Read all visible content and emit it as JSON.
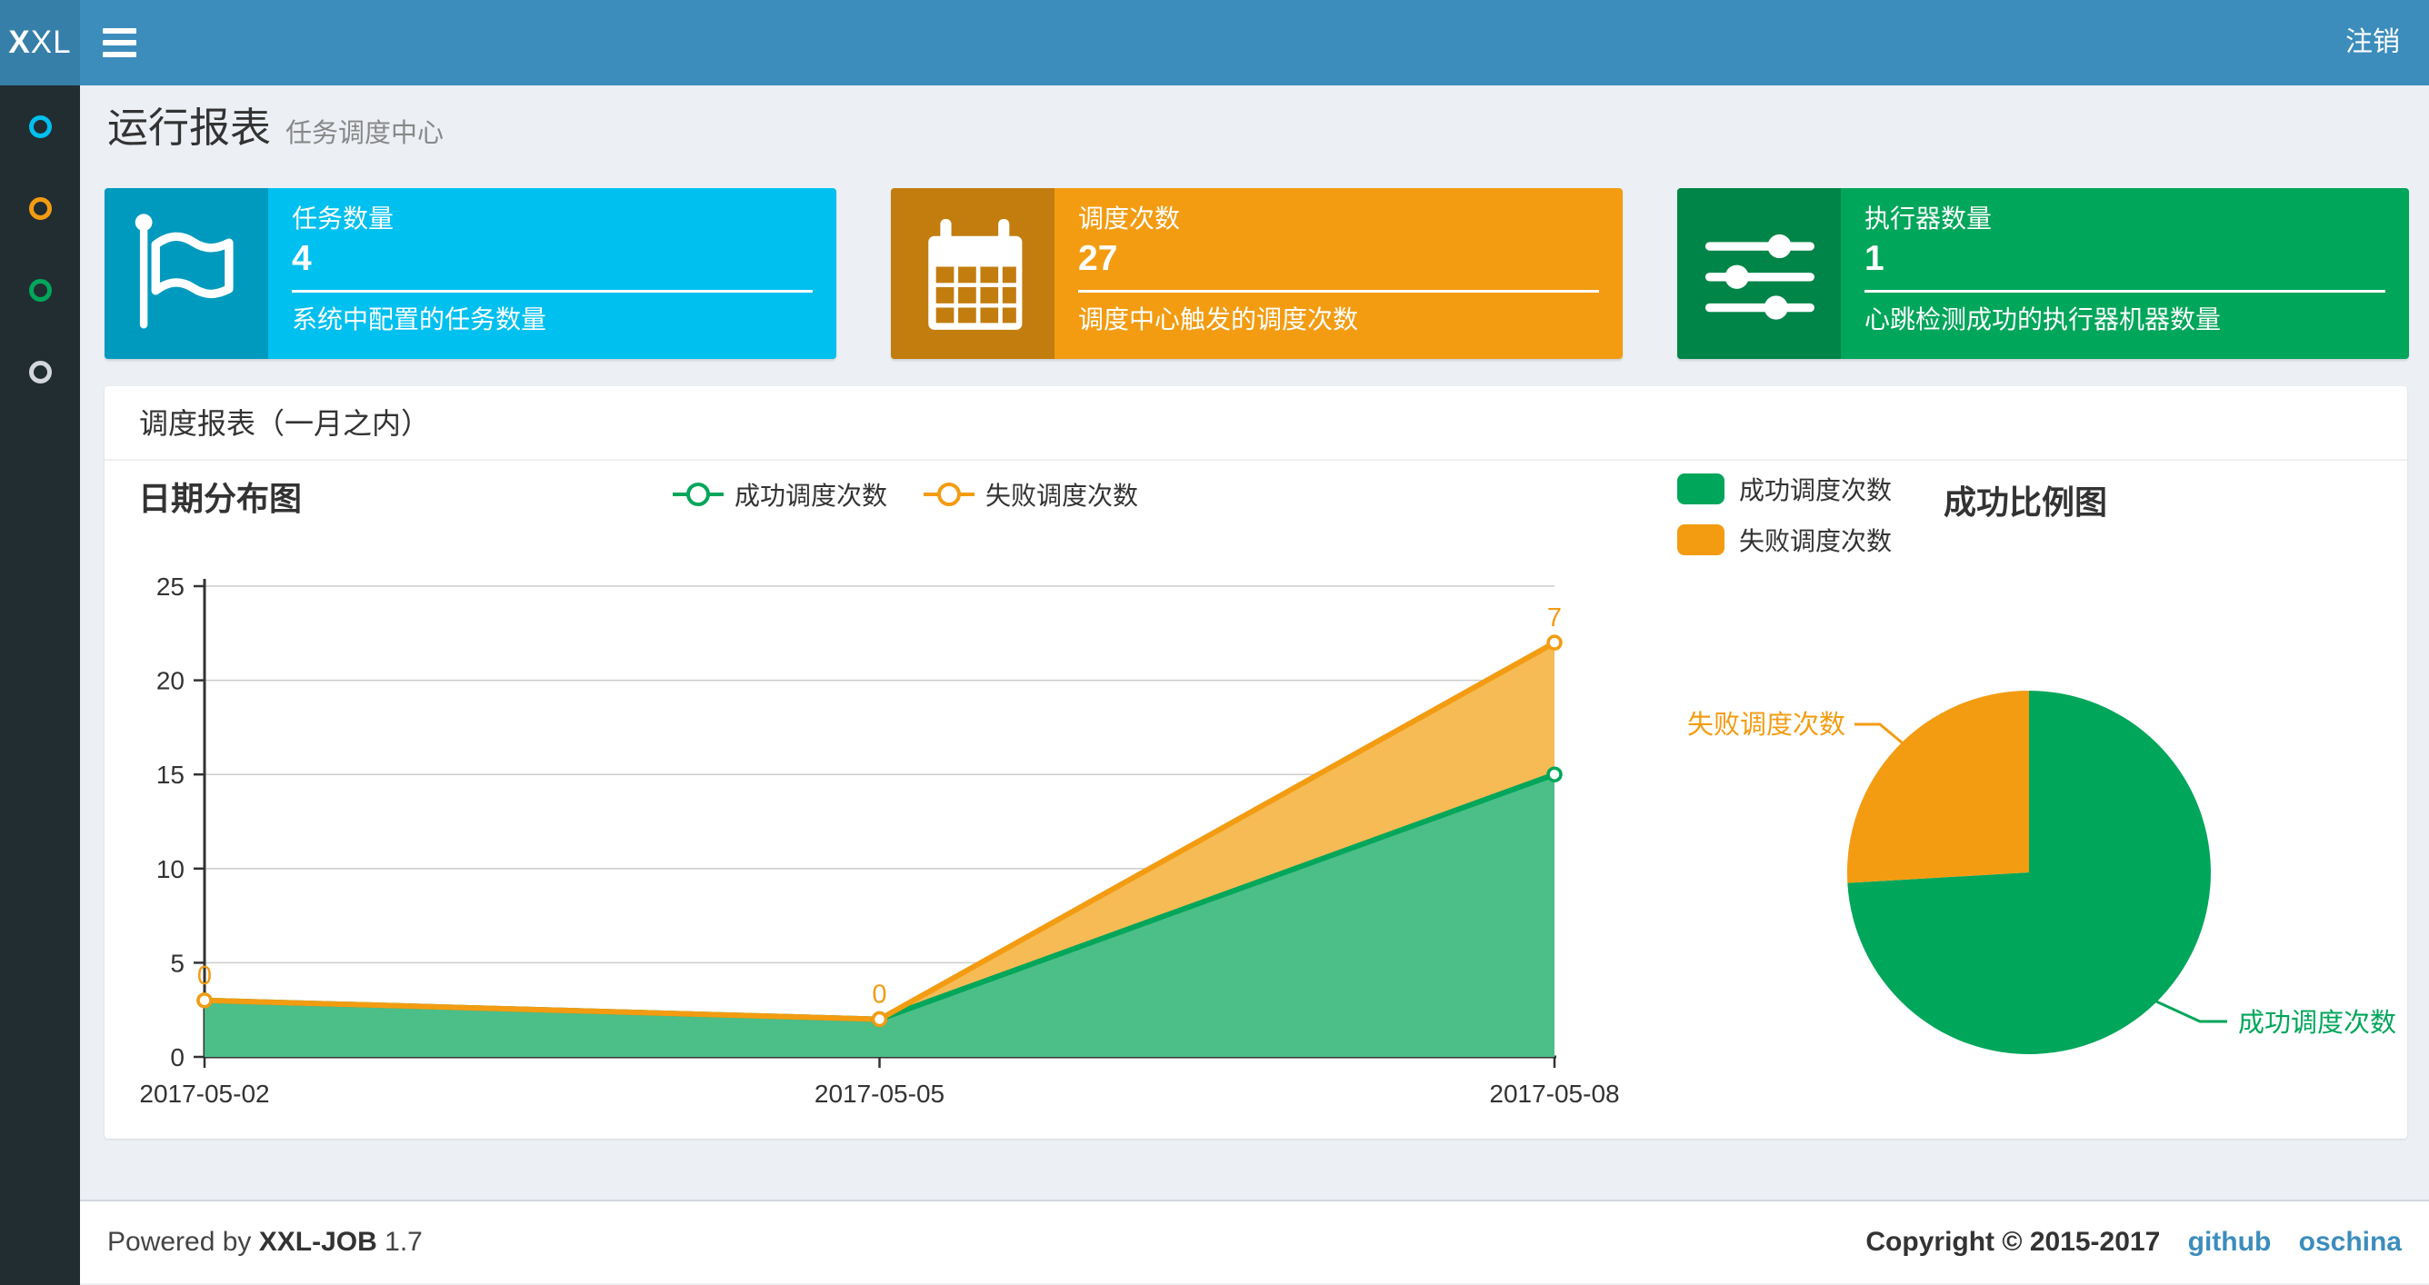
{
  "navbar": {
    "logo_bold": "X",
    "logo_rest": "XL",
    "logout": "注销"
  },
  "sidebar": {
    "items": [
      {
        "icon": "circle-icon",
        "color": "#00c0ef"
      },
      {
        "icon": "circle-icon",
        "color": "#f39c12"
      },
      {
        "icon": "circle-icon",
        "color": "#00a65a"
      },
      {
        "icon": "circle-icon",
        "color": "#d2d6de"
      }
    ]
  },
  "page_header": {
    "title": "运行报表",
    "subtitle": "任务调度中心"
  },
  "stat_cards": [
    {
      "label": "任务数量",
      "value": "4",
      "desc": "系统中配置的任务数量",
      "color": "#00c0ef",
      "icon": "flag-icon"
    },
    {
      "label": "调度次数",
      "value": "27",
      "desc": "调度中心触发的调度次数",
      "color": "#f39c12",
      "icon": "calendar-icon"
    },
    {
      "label": "执行器数量",
      "value": "1",
      "desc": "心跳检测成功的执行器机器数量",
      "color": "#00a65a",
      "icon": "sliders-icon"
    }
  ],
  "panel": {
    "title": "调度报表（一月之内）"
  },
  "chart_data": [
    {
      "type": "area",
      "title": "日期分布图",
      "stacked": true,
      "categories": [
        "2017-05-02",
        "2017-05-05",
        "2017-05-08"
      ],
      "series": [
        {
          "name": "成功调度次数",
          "color": "#00a65a",
          "area": "#4cbe88",
          "values": [
            3,
            2,
            15
          ]
        },
        {
          "name": "失败调度次数",
          "color": "#f39c12",
          "area": "#f6bb55",
          "values": [
            0,
            0,
            7
          ],
          "labels": [
            "0",
            "0",
            "7"
          ]
        }
      ],
      "ylim": [
        0,
        25
      ],
      "yticks": [
        0,
        5,
        10,
        15,
        20,
        25
      ],
      "legend_position": "top",
      "grid": true
    },
    {
      "type": "pie",
      "title": "成功比例图",
      "slices": [
        {
          "name": "成功调度次数",
          "value": 20,
          "color": "#00a65a"
        },
        {
          "name": "失败调度次数",
          "value": 7,
          "color": "#f39c12"
        }
      ],
      "legend_position": "left"
    }
  ],
  "footer": {
    "powered_by": "Powered by",
    "brand": "XXL-JOB",
    "version": "1.7",
    "copyright": "Copyright © 2015-2017",
    "links": [
      "github",
      "oschina"
    ]
  }
}
